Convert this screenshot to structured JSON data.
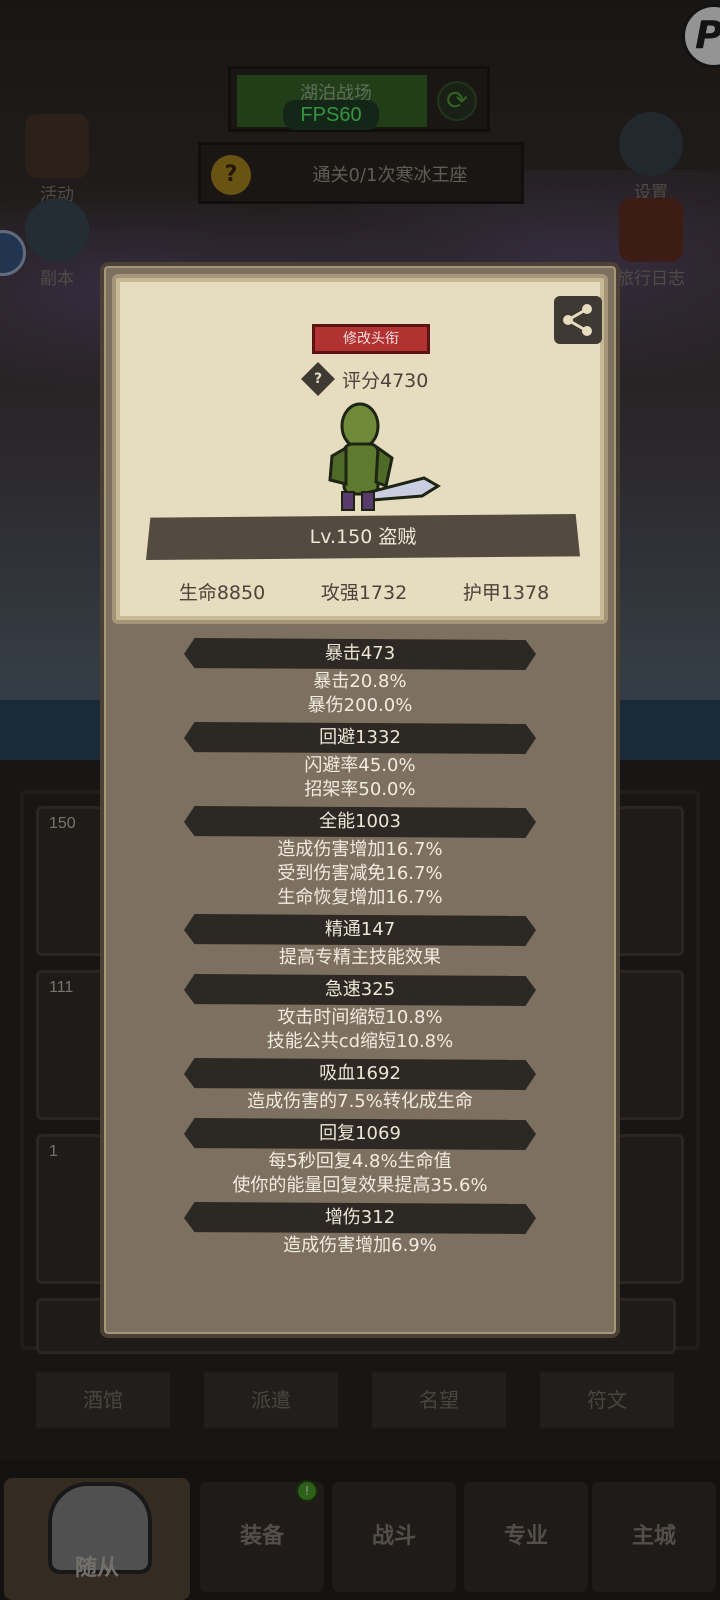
{
  "hud": {
    "map_name": "湖泊战场",
    "fps": "FPS60",
    "quest_text": "通关0/1次寒冰王座",
    "quest_icon": "?",
    "corner_icon": "P"
  },
  "side_buttons": {
    "activity": "活动",
    "dungeon": "副本",
    "settings": "设置",
    "journal": "旅行日志"
  },
  "roster": {
    "slot_levels": [
      "150",
      "111",
      "1"
    ]
  },
  "sub_tabs": [
    "酒馆",
    "派遣",
    "名望",
    "符文"
  ],
  "nav": {
    "items": [
      "随从",
      "装备",
      "战斗",
      "专业",
      "主城"
    ],
    "badge": "!"
  },
  "character": {
    "edit_title_label": "修改头衔",
    "score": "评分4730",
    "score_icon": "?",
    "level_class": "Lv.150 盗贼",
    "base_stats": [
      "生命8850",
      "攻强1732",
      "护甲1378"
    ]
  },
  "stats": [
    {
      "name": "暴击473",
      "lines": [
        "暴击20.8%",
        "暴伤200.0%"
      ]
    },
    {
      "name": "回避1332",
      "lines": [
        "闪避率45.0%",
        "招架率50.0%"
      ]
    },
    {
      "name": "全能1003",
      "lines": [
        "造成伤害增加16.7%",
        "受到伤害减免16.7%",
        "生命恢复增加16.7%"
      ]
    },
    {
      "name": "精通147",
      "lines": [
        "提高专精主技能效果"
      ]
    },
    {
      "name": "急速325",
      "lines": [
        "攻击时间缩短10.8%",
        "技能公共cd缩短10.8%"
      ]
    },
    {
      "name": "吸血1692",
      "lines": [
        "造成伤害的7.5%转化成生命"
      ]
    },
    {
      "name": "回复1069",
      "lines": [
        "每5秒回复4.8%生命值",
        "使你的能量回复效果提高35.6%"
      ]
    },
    {
      "name": "增伤312",
      "lines": [
        "造成伤害增加6.9%"
      ]
    }
  ]
}
